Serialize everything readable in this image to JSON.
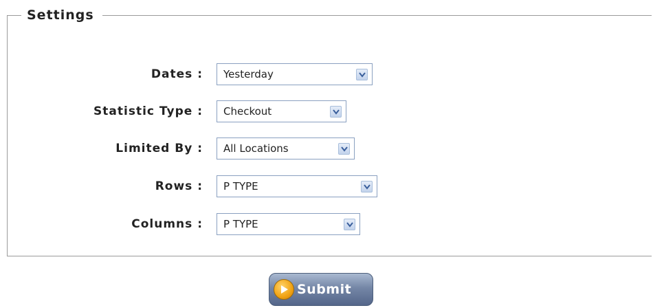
{
  "settings": {
    "legend": "Settings",
    "fields": [
      {
        "label": "Dates :",
        "value": "Yesterday"
      },
      {
        "label": "Statistic Type :",
        "value": "Checkout"
      },
      {
        "label": "Limited By :",
        "value": "All Locations"
      },
      {
        "label": "Rows :",
        "value": "P TYPE"
      },
      {
        "label": "Columns :",
        "value": "P TYPE"
      }
    ]
  },
  "submit": {
    "label": "Submit",
    "icon": "play-circle-icon"
  }
}
